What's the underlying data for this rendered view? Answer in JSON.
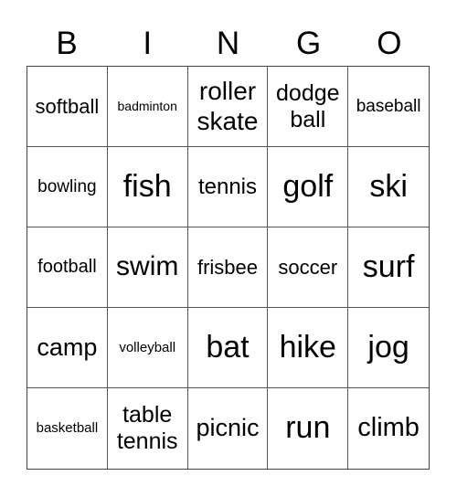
{
  "header": {
    "letters": [
      "B",
      "I",
      "N",
      "G",
      "O"
    ]
  },
  "cells": [
    {
      "text": "softball",
      "size": "s22"
    },
    {
      "text": "badminton",
      "size": "s14"
    },
    {
      "text": "roller skate",
      "size": "s28"
    },
    {
      "text": "dodge ball",
      "size": "s25"
    },
    {
      "text": "baseball",
      "size": "s19"
    },
    {
      "text": "bowling",
      "size": "s19"
    },
    {
      "text": "fish",
      "size": "s34"
    },
    {
      "text": "tennis",
      "size": "s24"
    },
    {
      "text": "golf",
      "size": "s34"
    },
    {
      "text": "ski",
      "size": "s34"
    },
    {
      "text": "football",
      "size": "s20"
    },
    {
      "text": "swim",
      "size": "s30"
    },
    {
      "text": "frisbee",
      "size": "s22"
    },
    {
      "text": "soccer",
      "size": "s22"
    },
    {
      "text": "surf",
      "size": "s34"
    },
    {
      "text": "camp",
      "size": "s27"
    },
    {
      "text": "volleyball",
      "size": "s15"
    },
    {
      "text": "bat",
      "size": "s34"
    },
    {
      "text": "hike",
      "size": "s34"
    },
    {
      "text": "jog",
      "size": "s34"
    },
    {
      "text": "basketball",
      "size": "s15"
    },
    {
      "text": "table tennis",
      "size": "s25"
    },
    {
      "text": "picnic",
      "size": "s27"
    },
    {
      "text": "run",
      "size": "s34"
    },
    {
      "text": "climb",
      "size": "s29"
    }
  ]
}
